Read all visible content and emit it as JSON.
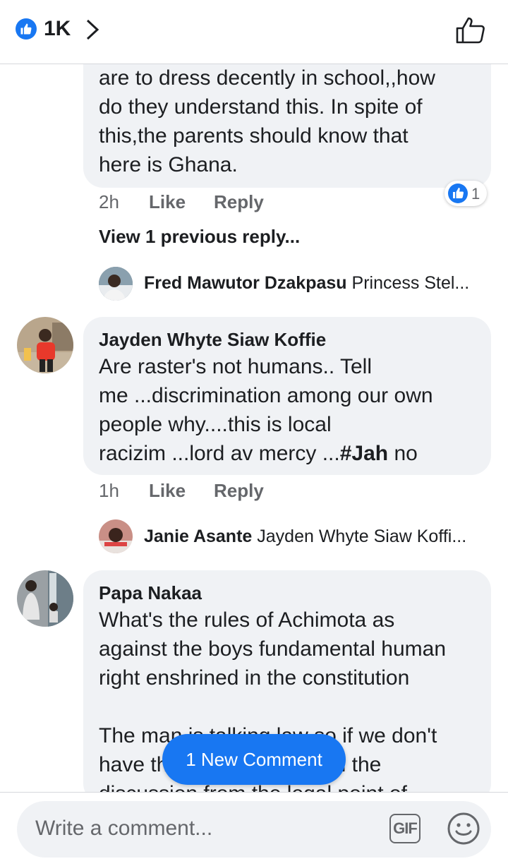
{
  "header": {
    "reaction_count": "1K"
  },
  "comments": [
    {
      "text": "are to dress decently in school,,how\ndo they understand this. In spite of\nthis,the parents should know that\nhere is Ghana.",
      "time": "2h",
      "like": "Like",
      "reply": "Reply",
      "reaction_count": "1"
    },
    {
      "author": "Jayden Whyte Siaw Koffie",
      "text_pre": "Are raster's not humans.. Tell\nme ...discrimination among our own\npeople why....this is local\nracizim ...lord av mercy ...",
      "text_bold": "#Jah",
      "text_post": " no",
      "time": "1h",
      "like": "Like",
      "reply": "Reply"
    },
    {
      "author": "Papa Nakaa",
      "text": "What's the rules of Achimota as\nagainst the boys fundamental human\nright enshrined in the constitution\n\nThe man is talking law so if we don't\nhave the legal language in the\ndiscussion from the legal point of"
    }
  ],
  "view_previous": "View 1 previous reply...",
  "replies": [
    {
      "author": "Fred Mawutor Dzakpasu",
      "preview": "Princess Stel..."
    },
    {
      "author": "Janie Asante",
      "preview": "Jayden Whyte Siaw Koffi..."
    }
  ],
  "new_comment_label": "1 New Comment",
  "composer": {
    "placeholder": "Write a comment...",
    "gif_label": "GIF"
  },
  "colors": {
    "accent": "#1877f2",
    "bubble": "#f0f2f5",
    "meta": "#65676b"
  }
}
